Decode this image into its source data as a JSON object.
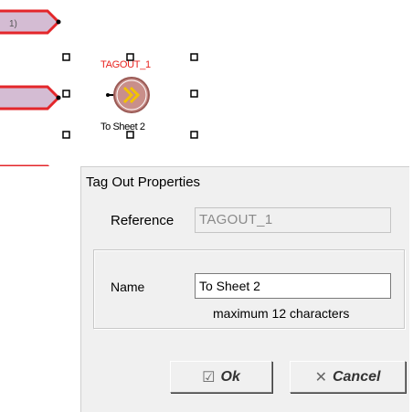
{
  "canvas": {
    "tag_reference": "TAGOUT_1",
    "tag_name": "To Sheet 2"
  },
  "dialog": {
    "title": "Tag Out Properties",
    "reference_label": "Reference",
    "reference_value": "TAGOUT_1",
    "name_label": "Name",
    "name_value": "To Sheet 2",
    "hint": "maximum 12 characters",
    "ok_label": "Ok",
    "cancel_label": "Cancel"
  },
  "icons": {
    "ok_icon": "check-box-icon",
    "cancel_icon": "x-icon",
    "tag_icon": "double-chevron-icon"
  },
  "colors": {
    "connector_border": "#e3262a",
    "connector_fill": "#d4bcd3",
    "tag_circle": "#c98f8a",
    "reference_text": "#e8231f"
  }
}
